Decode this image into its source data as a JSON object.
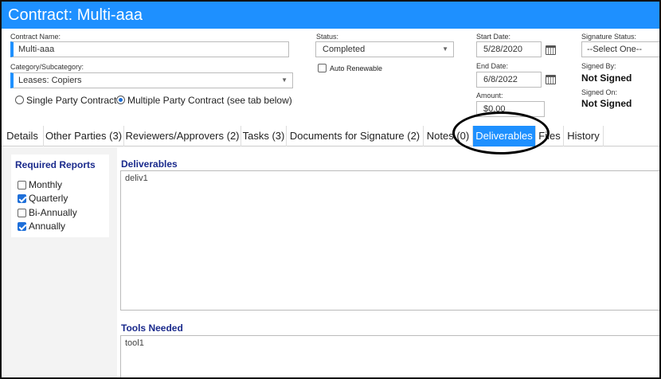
{
  "window": {
    "title": "Contract: Multi-aaa"
  },
  "contract": {
    "name_label": "Contract Name:",
    "name_value": "Multi-aaa",
    "category_label": "Category/Subcategory:",
    "category_value": "Leases: Copiers",
    "single_party_label": "Single Party Contract",
    "multiple_party_label": "Multiple Party Contract (see tab below)",
    "selected_party_option": "multiple"
  },
  "status": {
    "label": "Status:",
    "value": "Completed",
    "auto_renew_label": "Auto Renewable",
    "auto_renew_checked": false
  },
  "dates": {
    "start_label": "Start Date:",
    "start_value": "5/28/2020",
    "end_label": "End Date:",
    "end_value": "6/8/2022",
    "amount_label": "Amount:",
    "amount_value": "$0.00"
  },
  "signature": {
    "status_label": "Signature Status:",
    "status_value": "--Select One--",
    "signed_by_label": "Signed By:",
    "signed_by_value": "Not Signed",
    "signed_on_label": "Signed On:",
    "signed_on_value": "Not Signed"
  },
  "tabs": [
    {
      "label": "Details",
      "active": false
    },
    {
      "label": "Other Parties (3)",
      "active": false
    },
    {
      "label": "Reviewers/Approvers (2)",
      "active": false
    },
    {
      "label": "Tasks (3)",
      "active": false
    },
    {
      "label": "Documents for Signature (2)",
      "active": false
    },
    {
      "label": "Notes (0)",
      "active": false
    },
    {
      "label": "Deliverables",
      "active": true
    },
    {
      "label": "Files",
      "active": false
    },
    {
      "label": "History",
      "active": false
    }
  ],
  "required_reports": {
    "title": "Required Reports",
    "items": [
      {
        "label": "Monthly",
        "checked": false
      },
      {
        "label": "Quarterly",
        "checked": true
      },
      {
        "label": "Bi-Annually",
        "checked": false
      },
      {
        "label": "Annually",
        "checked": true
      }
    ]
  },
  "deliverables": {
    "title": "Deliverables",
    "value": "deliv1"
  },
  "tools": {
    "title": "Tools Needed",
    "value": "tool1"
  },
  "colors": {
    "accent": "#1e90ff",
    "section_title": "#1a2a8c",
    "annotation": "#000000"
  }
}
